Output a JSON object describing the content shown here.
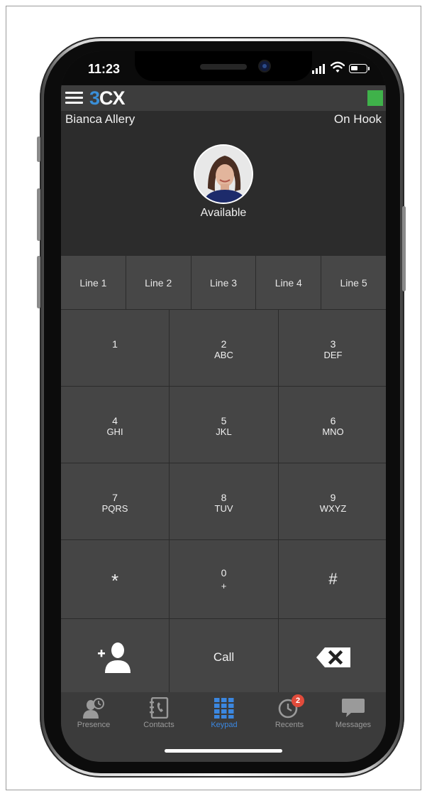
{
  "status_bar": {
    "time": "11:23"
  },
  "app_bar": {
    "logo_prefix": "3",
    "logo_suffix": "CX",
    "status_color": "#3fb24a"
  },
  "profile": {
    "name": "Bianca Allery",
    "hook_status": "On Hook",
    "availability": "Available"
  },
  "lines": [
    "Line 1",
    "Line 2",
    "Line 3",
    "Line 4",
    "Line 5"
  ],
  "keypad": {
    "keys": [
      {
        "digit": "1",
        "letters": ""
      },
      {
        "digit": "2",
        "letters": "ABC"
      },
      {
        "digit": "3",
        "letters": "DEF"
      },
      {
        "digit": "4",
        "letters": "GHI"
      },
      {
        "digit": "5",
        "letters": "JKL"
      },
      {
        "digit": "6",
        "letters": "MNO"
      },
      {
        "digit": "7",
        "letters": "PQRS"
      },
      {
        "digit": "8",
        "letters": "TUV"
      },
      {
        "digit": "9",
        "letters": "WXYZ"
      },
      {
        "digit": "*",
        "letters": ""
      },
      {
        "digit": "0",
        "letters": "+"
      },
      {
        "digit": "#",
        "letters": ""
      }
    ],
    "call_label": "Call",
    "add_contact_icon": "add-contact-icon",
    "backspace_icon": "backspace-icon"
  },
  "tabs": [
    {
      "label": "Presence",
      "icon": "presence-icon",
      "active": false
    },
    {
      "label": "Contacts",
      "icon": "contacts-icon",
      "active": false
    },
    {
      "label": "Keypad",
      "icon": "keypad-icon",
      "active": true
    },
    {
      "label": "Recents",
      "icon": "recents-icon",
      "active": false,
      "badge": "2"
    },
    {
      "label": "Messages",
      "icon": "messages-icon",
      "active": false
    }
  ],
  "colors": {
    "accent": "#3b87e0",
    "badge": "#e14b3b",
    "logo_blue": "#3a8fd8"
  }
}
